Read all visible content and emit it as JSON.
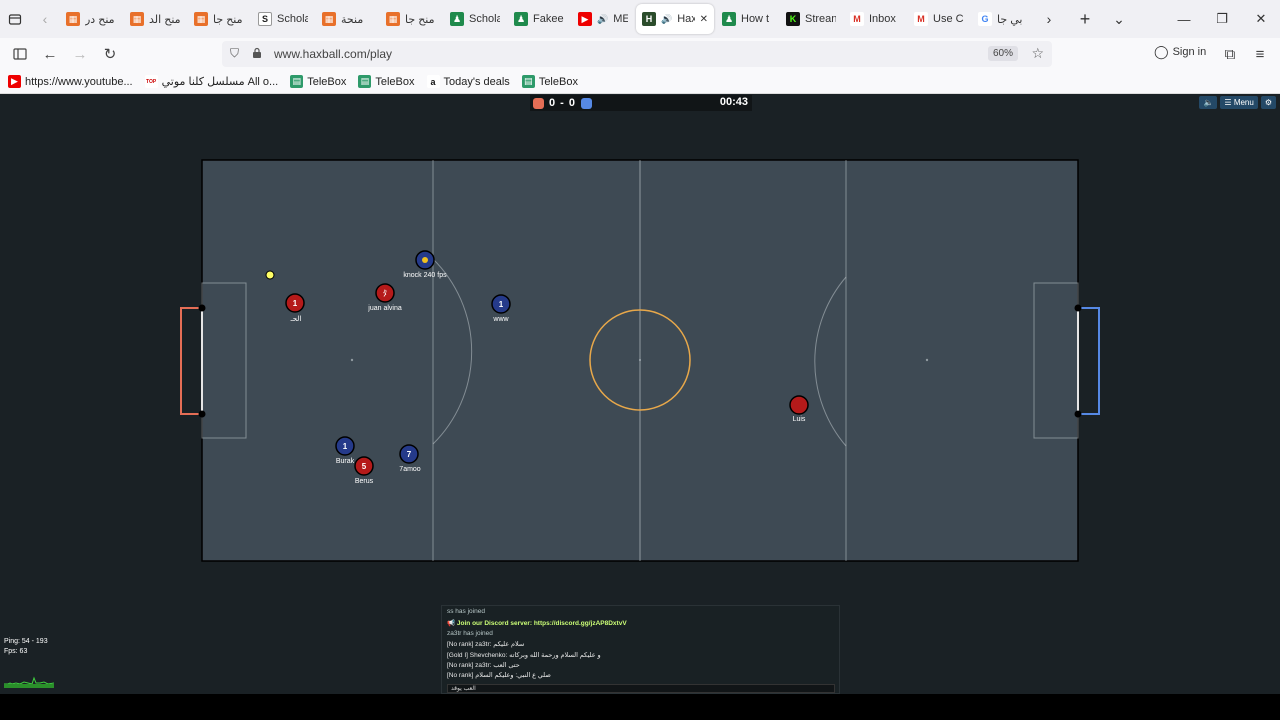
{
  "tabs": [
    {
      "label": "منح در",
      "favicon": "orange"
    },
    {
      "label": "منح الد",
      "favicon": "orange"
    },
    {
      "label": "منح جا",
      "favicon": "orange"
    },
    {
      "label": "Schola",
      "favicon": "scholar"
    },
    {
      "label": "منحة",
      "favicon": "orange"
    },
    {
      "label": "منح جا",
      "favicon": "orange"
    },
    {
      "label": "Schola",
      "favicon": "green"
    },
    {
      "label": "Fakeel",
      "favicon": "green"
    },
    {
      "label": "MENT",
      "favicon": "youtube"
    },
    {
      "label": "Hax",
      "favicon": "haxball",
      "active": true
    },
    {
      "label": "How t",
      "favicon": "green"
    },
    {
      "label": "Strean",
      "favicon": "kick"
    },
    {
      "label": "Inbox",
      "favicon": "gmail"
    },
    {
      "label": "Use C",
      "favicon": "gmail"
    },
    {
      "label": "بي جا",
      "favicon": "google"
    }
  ],
  "url": "www.haxball.com/play",
  "zoom": "60%",
  "signin_label": "Sign in",
  "bookmarks": [
    {
      "label": "https://www.youtube...",
      "favicon": "youtube"
    },
    {
      "label": "مسلسل كلنا موتي All o...",
      "favicon": "top"
    },
    {
      "label": "TeleBox",
      "favicon": "telebox"
    },
    {
      "label": "TeleBox",
      "favicon": "telebox"
    },
    {
      "label": "Today's deals",
      "favicon": "amazon"
    },
    {
      "label": "TeleBox",
      "favicon": "telebox"
    }
  ],
  "game": {
    "score_red": "0",
    "score_blue": "0",
    "score_text": "0 - 0",
    "time": "00:43",
    "menu_label": "☰ Menu",
    "colors": {
      "red_team": "#e56e56",
      "blue_team": "#5689e5",
      "pitch": "#3e4a54",
      "ball": "#ffff66"
    },
    "players": [
      {
        "name": "الحـ",
        "number": "1",
        "team": "red"
      },
      {
        "name": "juan alvina",
        "number": "ﾀ",
        "team": "red"
      },
      {
        "name": "knock 240 fps",
        "number": "",
        "team": "blue"
      },
      {
        "name": "www",
        "number": "1",
        "team": "blue"
      },
      {
        "name": "Burak",
        "number": "1",
        "team": "blue"
      },
      {
        "name": "Berus",
        "number": "5",
        "team": "red"
      },
      {
        "name": "7amoo",
        "number": "7",
        "team": "blue"
      },
      {
        "name": "Luis",
        "number": "",
        "team": "red"
      }
    ]
  },
  "stats": {
    "ping": "Ping: 54 - 193",
    "fps": "Fps: 63"
  },
  "chat": {
    "lines": [
      {
        "text": "ss has joined",
        "type": "joined"
      },
      {
        "text": "📢 Join our Discord server: https://discord.gg/jzAP8DxtvV",
        "type": "announce"
      },
      {
        "text": "za3tr has joined",
        "type": "joined"
      },
      {
        "text": "[No rank] za3tr: سلام عليكم",
        "type": "msg"
      },
      {
        "text": "[Gold I] Shevchenko: و عليكم السلام ورحمة الله وبركاته",
        "type": "msg"
      },
      {
        "text": "[No rank] za3tr: حتى العب",
        "type": "msg"
      },
      {
        "text": "[No rank] صلي ع النبي: وعليكم السلام",
        "type": "msg"
      }
    ],
    "input_value": "العب يوقد"
  }
}
